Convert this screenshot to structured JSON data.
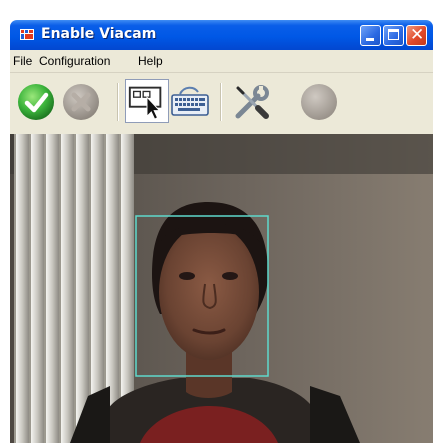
{
  "window": {
    "title": "Enable Viacam",
    "minimize_icon": "minimize-icon",
    "maximize_icon": "maximize-icon",
    "close_icon": "close-icon",
    "close_glyph": "✕"
  },
  "menu": {
    "items": [
      "File",
      "Configuration",
      "Help"
    ]
  },
  "toolbar": {
    "buttons": [
      {
        "icon": "enable-check-icon",
        "state": "active"
      },
      {
        "icon": "stop-icon",
        "state": "disabled"
      },
      {
        "icon": "click-window-icon",
        "state": "pressed"
      },
      {
        "icon": "onscreen-keyboard-icon",
        "state": "normal"
      },
      {
        "icon": "options-tools-icon",
        "state": "normal"
      },
      {
        "icon": "tracking-indicator-icon",
        "state": "disabled"
      }
    ]
  },
  "camera": {
    "content": "webcam-feed",
    "tracking_box_color": "#5fd9cc"
  },
  "colors": {
    "titlebar": "#0058e6",
    "chrome": "#ece9d8",
    "close_button": "#e1492a",
    "enable_green": "#3cb43c"
  }
}
